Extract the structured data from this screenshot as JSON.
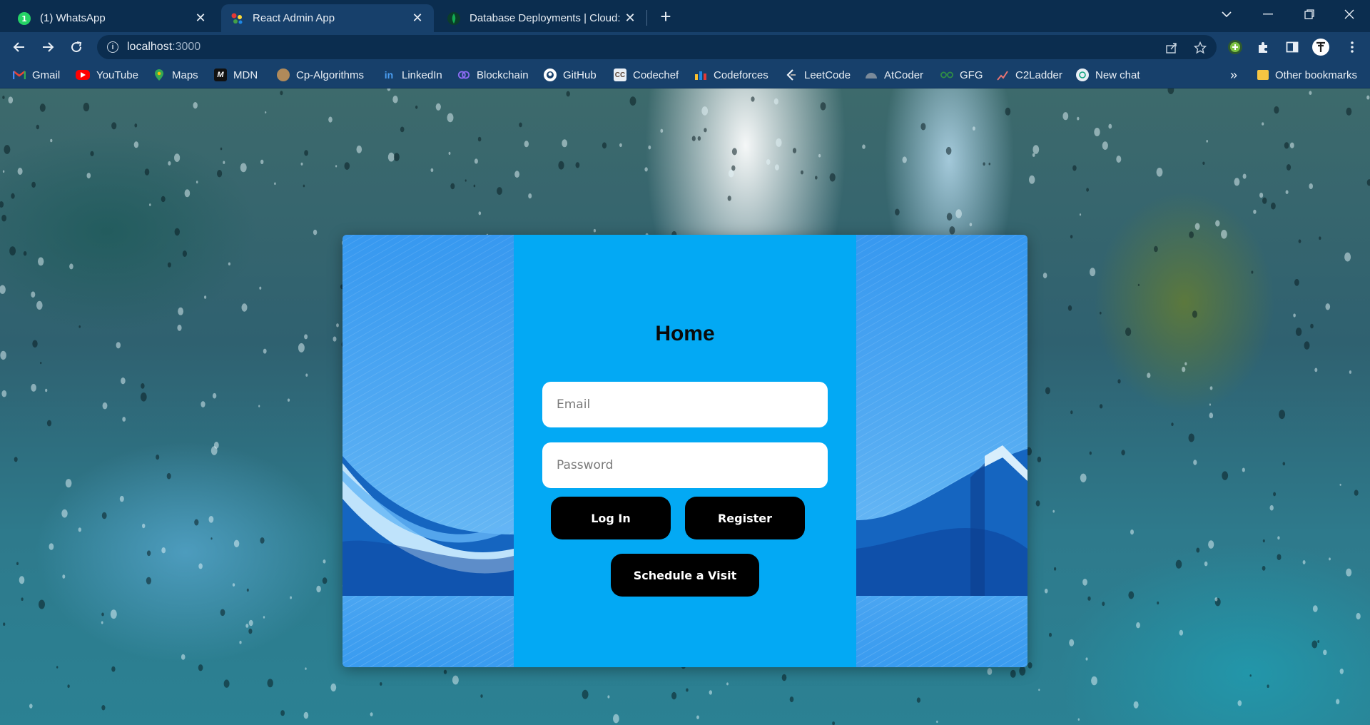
{
  "tabs": [
    {
      "title": "(1) WhatsApp",
      "favicon": "whatsapp-icon",
      "active": false
    },
    {
      "title": "React Admin App",
      "favicon": "react-admin-icon",
      "active": true
    },
    {
      "title": "Database Deployments | Cloud: M",
      "favicon": "mongodb-leaf-icon",
      "active": false
    }
  ],
  "address_bar": {
    "host": "localhost",
    "port": ":3000"
  },
  "bookmarks": [
    {
      "label": "Gmail",
      "icon": "gmail-icon"
    },
    {
      "label": "YouTube",
      "icon": "youtube-icon"
    },
    {
      "label": "Maps",
      "icon": "maps-icon"
    },
    {
      "label": "MDN",
      "icon": "mdn-icon"
    },
    {
      "label": "Cp-Algorithms",
      "icon": "cp-algorithms-icon"
    },
    {
      "label": "LinkedIn",
      "icon": "linkedin-icon"
    },
    {
      "label": "Blockchain",
      "icon": "blockchain-icon"
    },
    {
      "label": "GitHub",
      "icon": "github-icon"
    },
    {
      "label": "Codechef",
      "icon": "codechef-icon"
    },
    {
      "label": "Codeforces",
      "icon": "codeforces-icon"
    },
    {
      "label": "LeetCode",
      "icon": "leetcode-icon"
    },
    {
      "label": "AtCoder",
      "icon": "atcoder-icon"
    },
    {
      "label": "GFG",
      "icon": "gfg-icon"
    },
    {
      "label": "C2Ladder",
      "icon": "c2ladder-icon"
    },
    {
      "label": "New chat",
      "icon": "openai-icon"
    }
  ],
  "other_bookmarks": "Other bookmarks",
  "overflow_chevron": "»",
  "login": {
    "title": "Home",
    "email_placeholder": "Email",
    "password_placeholder": "Password",
    "login_label": "Log In",
    "register_label": "Register",
    "schedule_label": "Schedule a Visit"
  },
  "colors": {
    "browser_frame": "#0b2d4f",
    "toolbar": "#17406b",
    "panel_center": "#03a9f4",
    "panel_side": "#42a5f5",
    "button": "#000000"
  }
}
